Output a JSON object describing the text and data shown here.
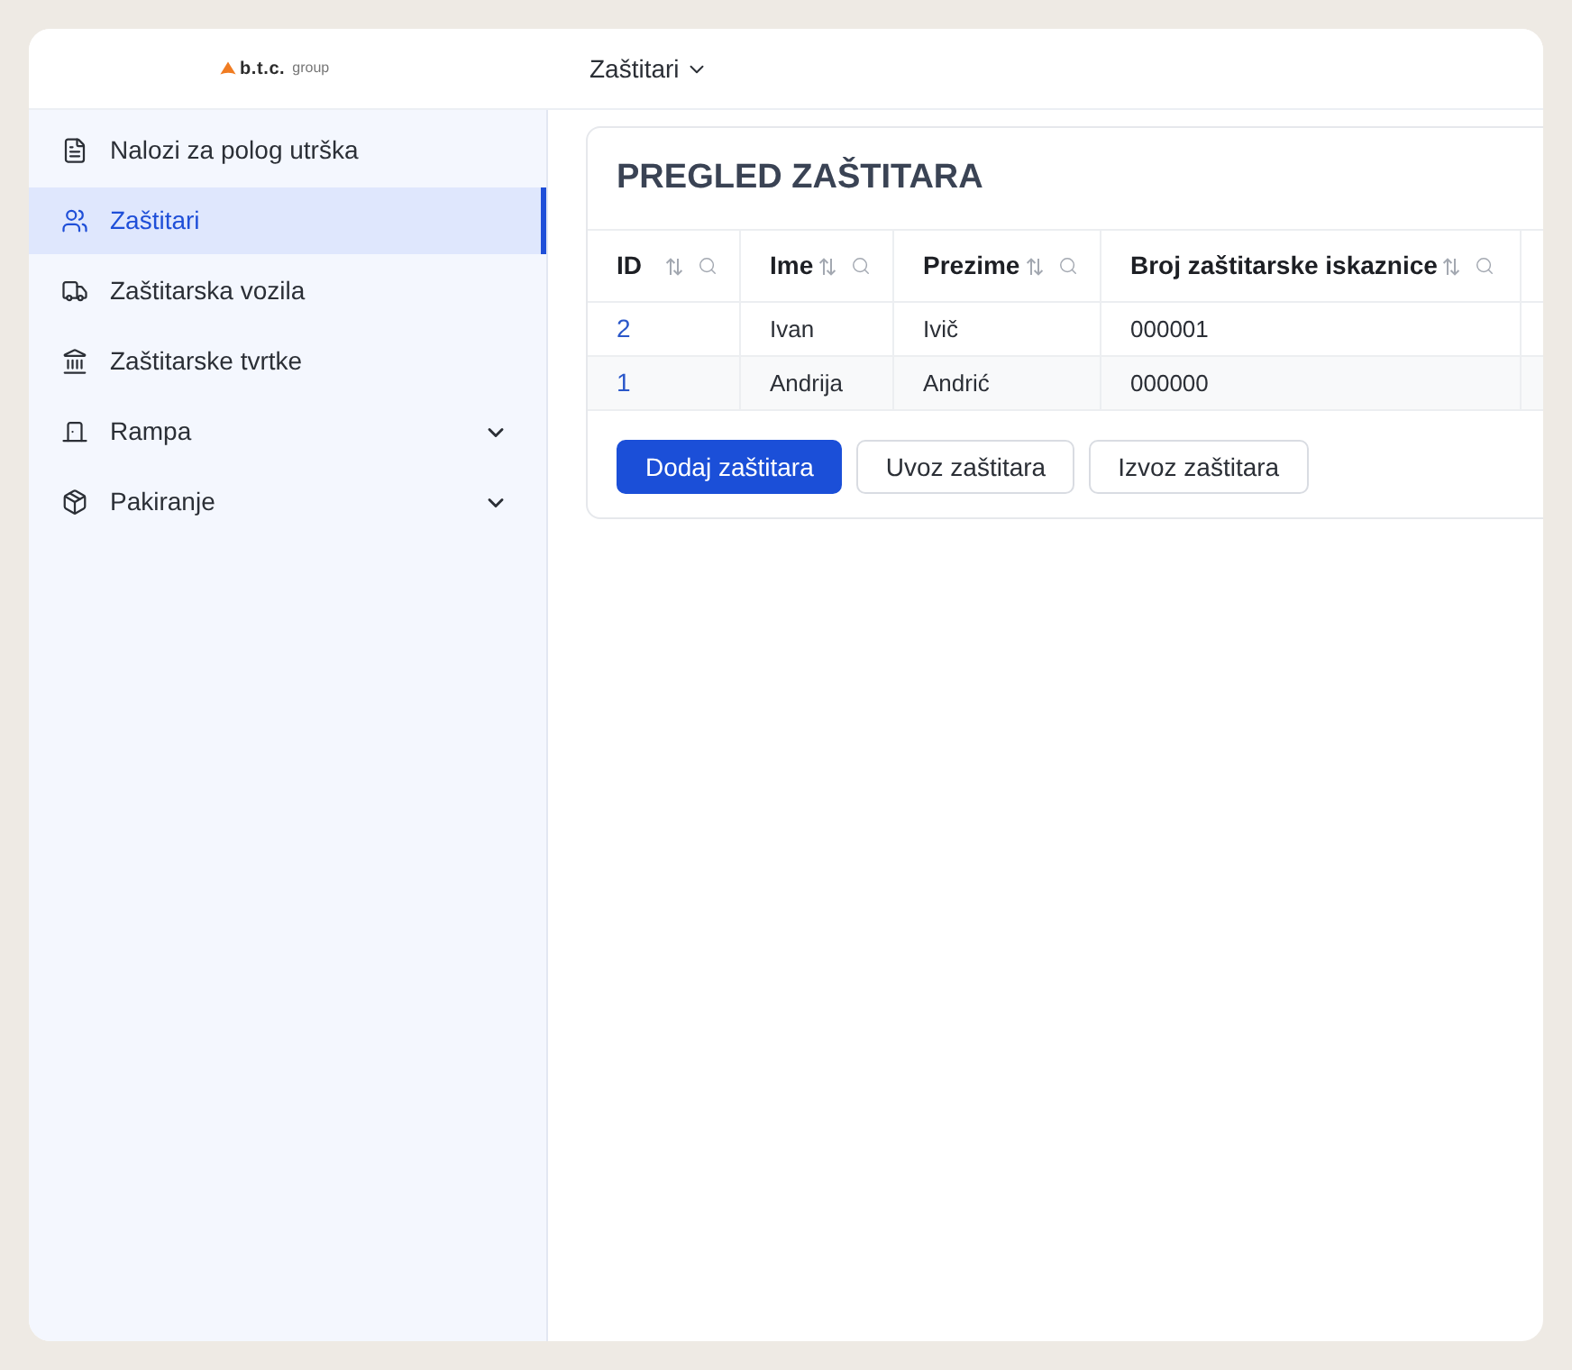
{
  "header": {
    "logo": {
      "mark": "b.t.c.",
      "word": "group"
    },
    "nav_menu": {
      "label": "Zaštitari"
    }
  },
  "sidebar": {
    "items": [
      {
        "label": "Nalozi za polog utrška",
        "kind": "link",
        "selected": false
      },
      {
        "label": "Zaštitari",
        "kind": "link",
        "selected": true
      },
      {
        "label": "Zaštitarska vozila",
        "kind": "link",
        "selected": false
      },
      {
        "label": "Zaštitarske tvrtke",
        "kind": "link",
        "selected": false
      },
      {
        "label": "Rampa",
        "kind": "group",
        "selected": false,
        "expanded": false
      },
      {
        "label": "Pakiranje",
        "kind": "group",
        "selected": false,
        "expanded": false
      }
    ]
  },
  "content": {
    "title": "PREGLED ZAŠTITARA",
    "table": {
      "columns": [
        {
          "label": "ID"
        },
        {
          "label": "Ime"
        },
        {
          "label": "Prezime"
        },
        {
          "label": "Broj zaštitarske iskaznice"
        }
      ],
      "rows": [
        {
          "cells": [
            "2",
            "Ivan",
            "Ivič",
            "000001"
          ]
        },
        {
          "cells": [
            "1",
            "Andrija",
            "Andrić",
            "000000"
          ]
        }
      ]
    },
    "buttons": [
      {
        "label": "Dodaj zaštitara",
        "kind": "primary"
      },
      {
        "label": "Uvoz zaštitara",
        "kind": "secondary"
      },
      {
        "label": "Izvoz zaštitara",
        "kind": "secondary"
      }
    ]
  }
}
